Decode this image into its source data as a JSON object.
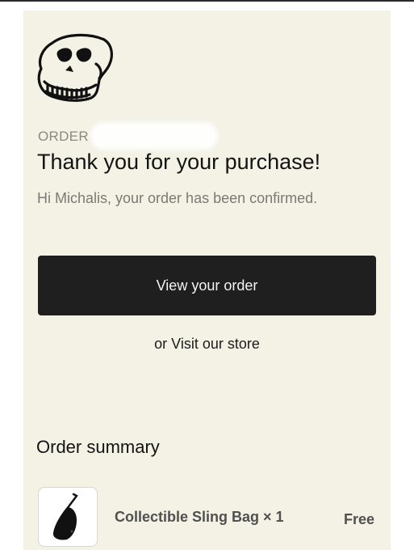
{
  "header": {
    "order_label": "ORDER",
    "title": "Thank you for your purchase!",
    "greeting": "Hi Michalis, your order has been confirmed."
  },
  "actions": {
    "view_order_label": "View your order",
    "or_text": "or",
    "visit_store_label": "Visit our store"
  },
  "summary": {
    "title": "Order summary",
    "items": [
      {
        "name": "Collectible Sling Bag × 1",
        "price": "Free",
        "icon": "sling-bag-icon"
      }
    ]
  },
  "colors": {
    "card_background": "#f4f1e5",
    "button_background": "#1f1f1f",
    "muted_text": "#7b7a74"
  }
}
